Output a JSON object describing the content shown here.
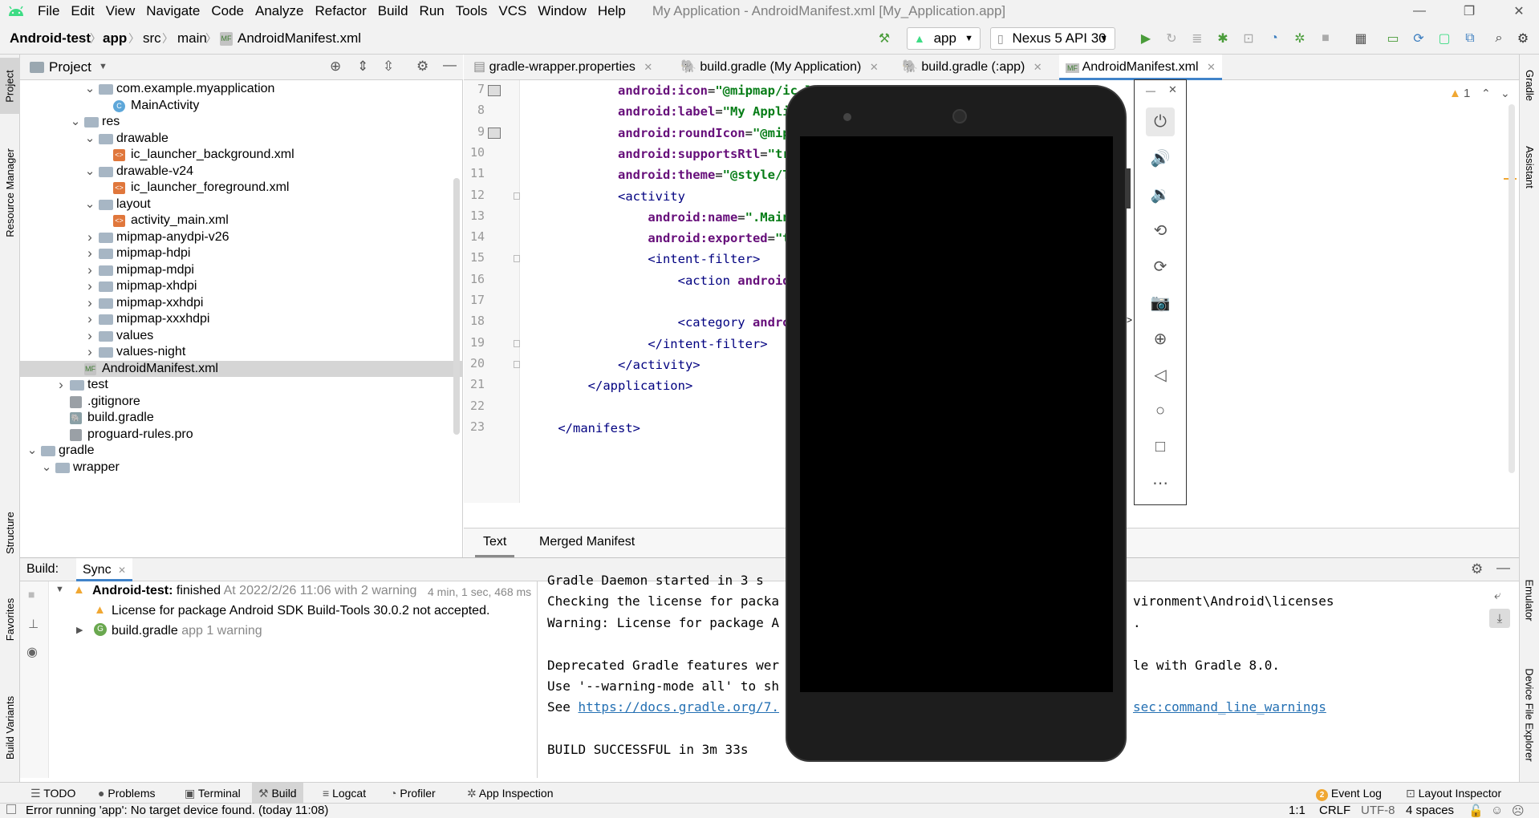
{
  "window": {
    "title": "My Application - AndroidManifest.xml [My_Application.app]",
    "menu": [
      "File",
      "Edit",
      "View",
      "Navigate",
      "Code",
      "Analyze",
      "Refactor",
      "Build",
      "Run",
      "Tools",
      "VCS",
      "Window",
      "Help"
    ]
  },
  "breadcrumb": [
    "Android-test",
    "app",
    "src",
    "main",
    "AndroidManifest.xml"
  ],
  "run_config": {
    "module": "app",
    "device": "Nexus 5 API 30"
  },
  "project_panel": {
    "title": "Project",
    "tree": [
      {
        "label": "com.example.myapplication",
        "kind": "package"
      },
      {
        "label": "MainActivity",
        "kind": "class"
      },
      {
        "label": "res",
        "kind": "folder"
      },
      {
        "label": "drawable",
        "kind": "folder"
      },
      {
        "label": "ic_launcher_background.xml",
        "kind": "xml"
      },
      {
        "label": "drawable-v24",
        "kind": "folder"
      },
      {
        "label": "ic_launcher_foreground.xml",
        "kind": "xml"
      },
      {
        "label": "layout",
        "kind": "folder"
      },
      {
        "label": "activity_main.xml",
        "kind": "xml"
      },
      {
        "label": "mipmap-anydpi-v26",
        "kind": "folder"
      },
      {
        "label": "mipmap-hdpi",
        "kind": "folder"
      },
      {
        "label": "mipmap-mdpi",
        "kind": "folder"
      },
      {
        "label": "mipmap-xhdpi",
        "kind": "folder"
      },
      {
        "label": "mipmap-xxhdpi",
        "kind": "folder"
      },
      {
        "label": "mipmap-xxxhdpi",
        "kind": "folder"
      },
      {
        "label": "values",
        "kind": "folder"
      },
      {
        "label": "values-night",
        "kind": "folder"
      },
      {
        "label": "AndroidManifest.xml",
        "kind": "manifest"
      },
      {
        "label": "test",
        "kind": "folder"
      },
      {
        "label": ".gitignore",
        "kind": "file"
      },
      {
        "label": "build.gradle",
        "kind": "gradle"
      },
      {
        "label": "proguard-rules.pro",
        "kind": "file"
      },
      {
        "label": "gradle",
        "kind": "folder"
      },
      {
        "label": "wrapper",
        "kind": "folder"
      }
    ]
  },
  "left_tool_tabs": [
    "Project",
    "Resource Manager",
    "Structure",
    "Favorites",
    "Build Variants"
  ],
  "right_tool_tabs": [
    "Gradle",
    "Assistant",
    "Emulator",
    "Device File Explorer"
  ],
  "editor_tabs": [
    "gradle-wrapper.properties",
    "build.gradle (My Application)",
    "build.gradle (:app)",
    "AndroidManifest.xml"
  ],
  "editor": {
    "warning_count": "1",
    "line_numbers": [
      "7",
      "8",
      "9",
      "10",
      "11",
      "12",
      "13",
      "14",
      "15",
      "16",
      "17",
      "18",
      "19",
      "20",
      "21",
      "22",
      "23"
    ],
    "lines": [
      {
        "indent": "            ",
        "a": "android:icon",
        "v": "\"@mipmap/ic_la"
      },
      {
        "indent": "            ",
        "a": "android:label",
        "v": "\"My Applica"
      },
      {
        "indent": "            ",
        "a": "android:roundIcon",
        "v": "\"@mipma"
      },
      {
        "indent": "            ",
        "a": "android:supportsRtl",
        "v": "\"true"
      },
      {
        "indent": "            ",
        "a": "android:theme",
        "v": "\"@style/The"
      },
      {
        "indent": "            ",
        "t": "<activity"
      },
      {
        "indent": "                ",
        "a": "android:name",
        "v": "\".MainA"
      },
      {
        "indent": "                ",
        "a": "android:exported",
        "v": "\"tr"
      },
      {
        "indent": "                ",
        "t": "<intent-filter>"
      },
      {
        "indent": "                    ",
        "t": "<action ",
        "a2": "android:"
      },
      {
        "indent": ""
      },
      {
        "indent": "                    ",
        "t": "<category ",
        "a2": "androi"
      },
      {
        "indent": "                ",
        "t": "</intent-filter>"
      },
      {
        "indent": "            ",
        "t": "</activity>"
      },
      {
        "indent": "        ",
        "t": "</application>"
      },
      {
        "indent": ""
      },
      {
        "indent": "    ",
        "t": "</manifest>"
      }
    ],
    "bottom_tabs": [
      "Text",
      "Merged Manifest"
    ]
  },
  "build_panel": {
    "label": "Build:",
    "tab": "Sync",
    "root_title": "Android-test:",
    "root_status": "finished",
    "root_detail": "At 2022/2/26 11:06 with 2 warning",
    "root_time": "4 min, 1 sec, 468 ms",
    "warning_item": "License for package Android SDK Build-Tools 30.0.2 not accepted.",
    "gradle_item": "build.gradle",
    "gradle_detail": "app 1 warning",
    "output": [
      "Gradle Daemon started in 3 s",
      "Checking the license for packa",
      "Warning: License for package A",
      "",
      "Deprecated Gradle features wer",
      "Use '--warning-mode all' to sh",
      "See ",
      "",
      "BUILD SUCCESSFUL in 3m 33s"
    ],
    "output_right": [
      "",
      "vironment\\Android\\licenses",
      ".",
      "",
      "le with Gradle 8.0.",
      "",
      "",
      "",
      ""
    ],
    "link_left": "https://docs.gradle.org/7.",
    "link_right": "sec:command_line_warnings"
  },
  "bottom_tool_tabs": [
    "TODO",
    "Problems",
    "Terminal",
    "Build",
    "Logcat",
    "Profiler",
    "App Inspection"
  ],
  "bottom_right_tabs": {
    "event_log": "Event Log",
    "event_count": "2",
    "layout_inspector": "Layout Inspector"
  },
  "status_bar": {
    "message": "Error running 'app': No target device found. (today 11:08)",
    "position": "1:1",
    "line_sep": "CRLF",
    "encoding": "UTF-8",
    "indent": "4 spaces"
  },
  "colors": {
    "accent": "#4083c9",
    "android_green": "#3ddc84",
    "warning": "#f0a732",
    "link": "#2470b3"
  }
}
